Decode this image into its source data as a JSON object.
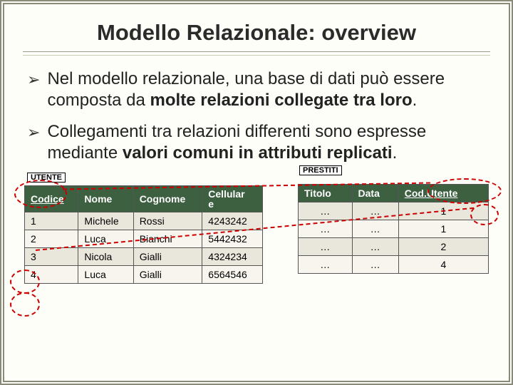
{
  "title": "Modello Relazionale: overview",
  "bullets": [
    {
      "pre": "Nel modello relazionale, una base di dati può essere composta da ",
      "bold": "molte relazioni collegate tra loro",
      "post": "."
    },
    {
      "pre": "Collegamenti tra relazioni differenti sono espresse mediante ",
      "bold": "valori comuni in attributi replicati",
      "post": "."
    }
  ],
  "labels": {
    "utente": "UTENTE",
    "prestiti": "PRESTITI"
  },
  "utente": {
    "headers": [
      "Codice",
      "Nome",
      "Cognome",
      "Cellulare"
    ],
    "header_cell_narrow": "Cellular\ne",
    "rows": [
      [
        "1",
        "Michele",
        "Rossi",
        "4243242"
      ],
      [
        "2",
        "Luca",
        "Bianchi",
        "5442432"
      ],
      [
        "3",
        "Nicola",
        "Gialli",
        "4324234"
      ],
      [
        "4",
        "Luca",
        "Gialli",
        "6564546"
      ]
    ]
  },
  "prestiti": {
    "headers": [
      "Titolo",
      "Data",
      "Cod.Utente"
    ],
    "rows": [
      [
        "…",
        "…",
        "1"
      ],
      [
        "…",
        "…",
        "1"
      ],
      [
        "…",
        "…",
        "2"
      ],
      [
        "…",
        "…",
        "4"
      ]
    ]
  },
  "chart_data": [
    {
      "type": "table",
      "title": "UTENTE",
      "columns": [
        "Codice",
        "Nome",
        "Cognome",
        "Cellulare"
      ],
      "rows": [
        [
          1,
          "Michele",
          "Rossi",
          "4243242"
        ],
        [
          2,
          "Luca",
          "Bianchi",
          "5442432"
        ],
        [
          3,
          "Nicola",
          "Gialli",
          "4324234"
        ],
        [
          4,
          "Luca",
          "Gialli",
          "6564546"
        ]
      ],
      "primary_key": "Codice"
    },
    {
      "type": "table",
      "title": "PRESTITI",
      "columns": [
        "Titolo",
        "Data",
        "Cod.Utente"
      ],
      "rows": [
        [
          "…",
          "…",
          1
        ],
        [
          "…",
          "…",
          1
        ],
        [
          "…",
          "…",
          2
        ],
        [
          "…",
          "…",
          4
        ]
      ],
      "foreign_key": "Cod.Utente"
    }
  ]
}
